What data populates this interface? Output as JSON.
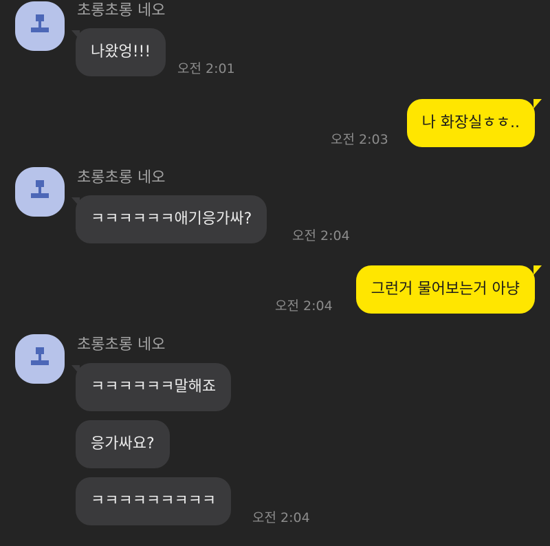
{
  "messages": {
    "g1": {
      "sender": "초롱초롱 네오",
      "bubbles": [
        "나왔엉!!!"
      ],
      "time": "오전 2:01"
    },
    "o1": {
      "text": "나 화장실ㅎㅎ..",
      "time": "오전 2:03"
    },
    "g2": {
      "sender": "초롱초롱 네오",
      "bubbles": [
        "ㅋㅋㅋㅋㅋㅋ애기응가싸?"
      ],
      "time": "오전 2:04"
    },
    "o2": {
      "text": "그런거 물어보는거 아냥",
      "time": "오전 2:04"
    },
    "g3": {
      "sender": "초롱초롱 네오",
      "bubbles": [
        "ㅋㅋㅋㅋㅋㅋ말해죠",
        "응가싸요?",
        "ㅋㅋㅋㅋㅋㅋㅋㅋㅋ"
      ],
      "time": "오전 2:04"
    }
  },
  "colors": {
    "background": "#242424",
    "incoming_bubble": "#3a3a3c",
    "outgoing_bubble": "#ffe600",
    "avatar": "#b7c3ea"
  },
  "icons": {
    "avatar": "default-profile-icon"
  }
}
